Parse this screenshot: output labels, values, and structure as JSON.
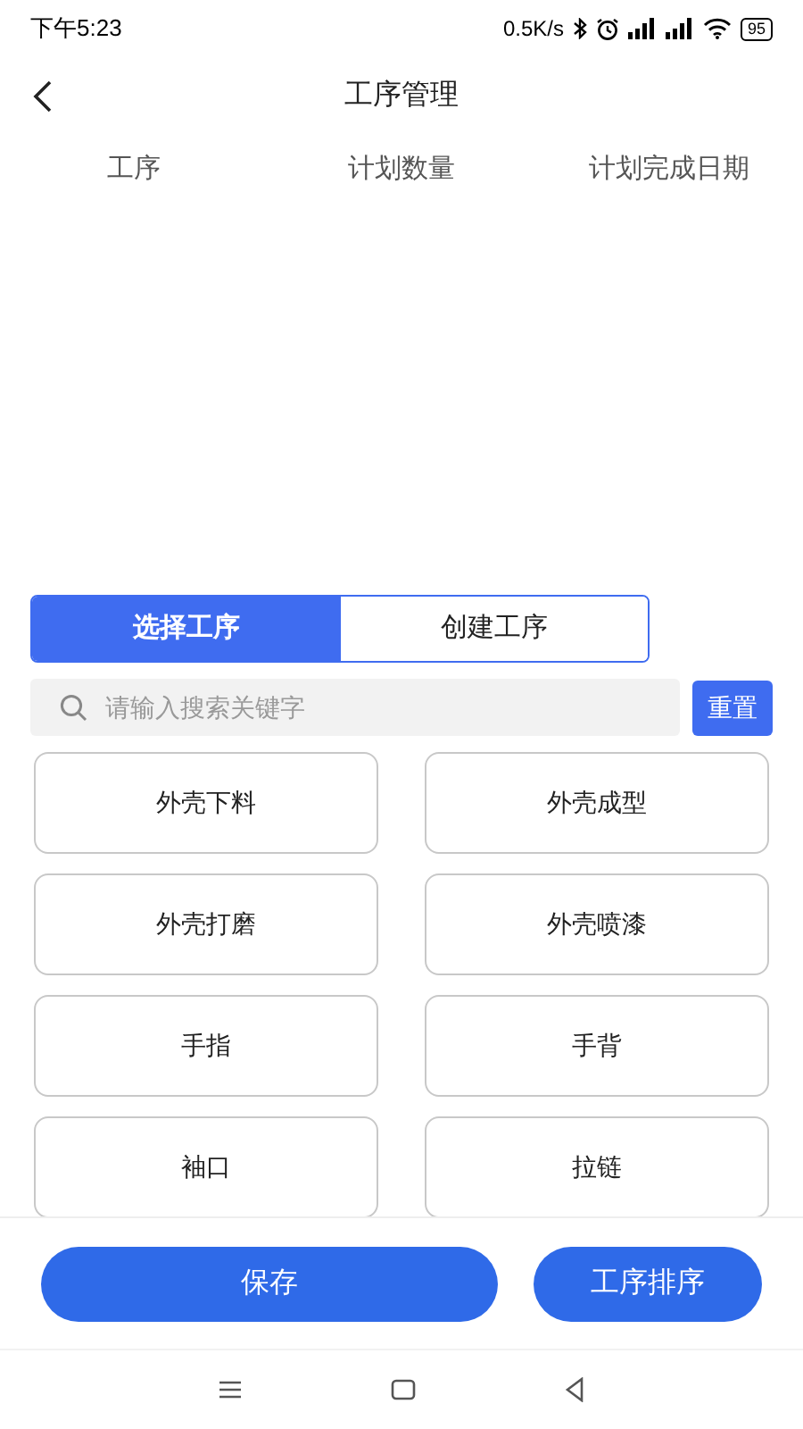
{
  "status_bar": {
    "time": "下午5:23",
    "speed": "0.5K/s",
    "battery": "95"
  },
  "header": {
    "title": "工序管理"
  },
  "table": {
    "columns": [
      "工序",
      "计划数量",
      "计划完成日期"
    ]
  },
  "tabs": [
    {
      "label": "选择工序",
      "selected": true
    },
    {
      "label": "创建工序",
      "selected": false
    }
  ],
  "search": {
    "placeholder": "请输入搜索关键字",
    "reset": "重置"
  },
  "processes": [
    "外壳下料",
    "外壳成型",
    "外壳打磨",
    "外壳喷漆",
    "手指",
    "手背",
    "袖口",
    "拉链"
  ],
  "footer": {
    "save": "保存",
    "sort": "工序排序"
  }
}
